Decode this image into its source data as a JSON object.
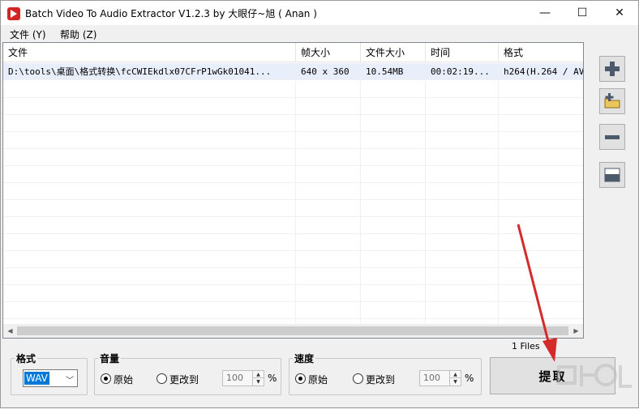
{
  "window": {
    "title": "Batch Video To Audio Extractor V1.2.3 by 大眼仔~旭 ( Anan )",
    "minimize": "—",
    "maximize": "☐",
    "close": "✕"
  },
  "menu": {
    "items": [
      "文件 (Y)",
      "帮助 (Z)"
    ]
  },
  "list": {
    "columns": [
      "文件",
      "帧大小",
      "文件大小",
      "时间",
      "格式"
    ],
    "rows": [
      [
        "D:\\tools\\桌面\\格式转换\\fcCWIEkdlx07CFrP1wGk01041...",
        "640 x 360",
        "10.54MB",
        "00:02:19...",
        "h264(H.264 / AV"
      ]
    ]
  },
  "side_buttons": [
    "plus-icon",
    "add-folder-icon",
    "minus-icon",
    "clear-icon"
  ],
  "files_count": "1 Files",
  "format_group": {
    "label": "格式",
    "selected": "WAV"
  },
  "volume_group": {
    "label": "音量",
    "option_original": "原始",
    "option_change": "更改到",
    "value": "100",
    "unit": "%"
  },
  "speed_group": {
    "label": "速度",
    "option_original": "原始",
    "option_change": "更改到",
    "value": "100",
    "unit": "%"
  },
  "extract_button": "提取",
  "colors": {
    "accent": "#0078d7",
    "arrow": "#d42a2a",
    "app_icon": "#d32525"
  }
}
